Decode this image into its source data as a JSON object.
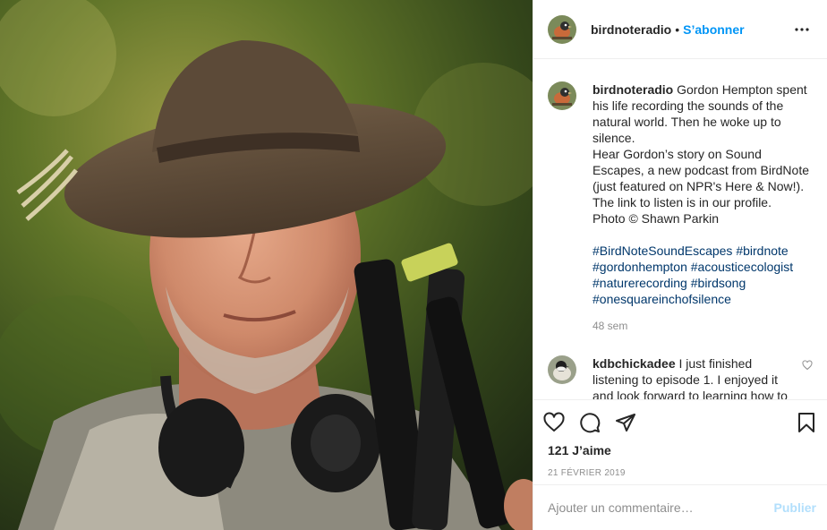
{
  "photo": {
    "subject_icon": "portrait-photo"
  },
  "header": {
    "username": "birdnoteradio",
    "separator": "•",
    "follow_label": "S’abonner",
    "more_icon": "more-horizontal-icon"
  },
  "caption": {
    "username": "birdnoteradio",
    "lines": [
      "Gordon Hempton spent his life recording the sounds of the natural world. Then he woke up to silence.",
      "Hear Gordon’s story on Sound Escapes, a new podcast from BirdNote (just featured on NPR's Here & Now!). The link to listen is in our profile.",
      "Photo © Shawn Parkin"
    ],
    "hashtags": [
      "#BirdNoteSoundEscapes",
      "#birdnote",
      "#gordonhempton",
      "#acousticecologist",
      "#naturerecording",
      "#birdsong",
      "#onesquareinchofsilence"
    ],
    "time": "48 sem"
  },
  "comment": {
    "username": "kdbchickadee",
    "text": "I just finished listening to episode 1. I enjoyed it and look forward to learning how to"
  },
  "actions": {
    "like_icon": "heart-icon",
    "comment_icon": "comment-icon",
    "share_icon": "paper-plane-icon",
    "save_icon": "bookmark-icon",
    "likes": "121 J’aime",
    "date": "21 FÉVRIER 2019"
  },
  "add_comment": {
    "placeholder": "Ajouter un commentaire…",
    "publish_label": "Publier"
  },
  "colors": {
    "accent": "#0095f6",
    "hashtag": "#00376b",
    "muted": "#8e8e8e",
    "publish_disabled": "#b2dffc"
  }
}
